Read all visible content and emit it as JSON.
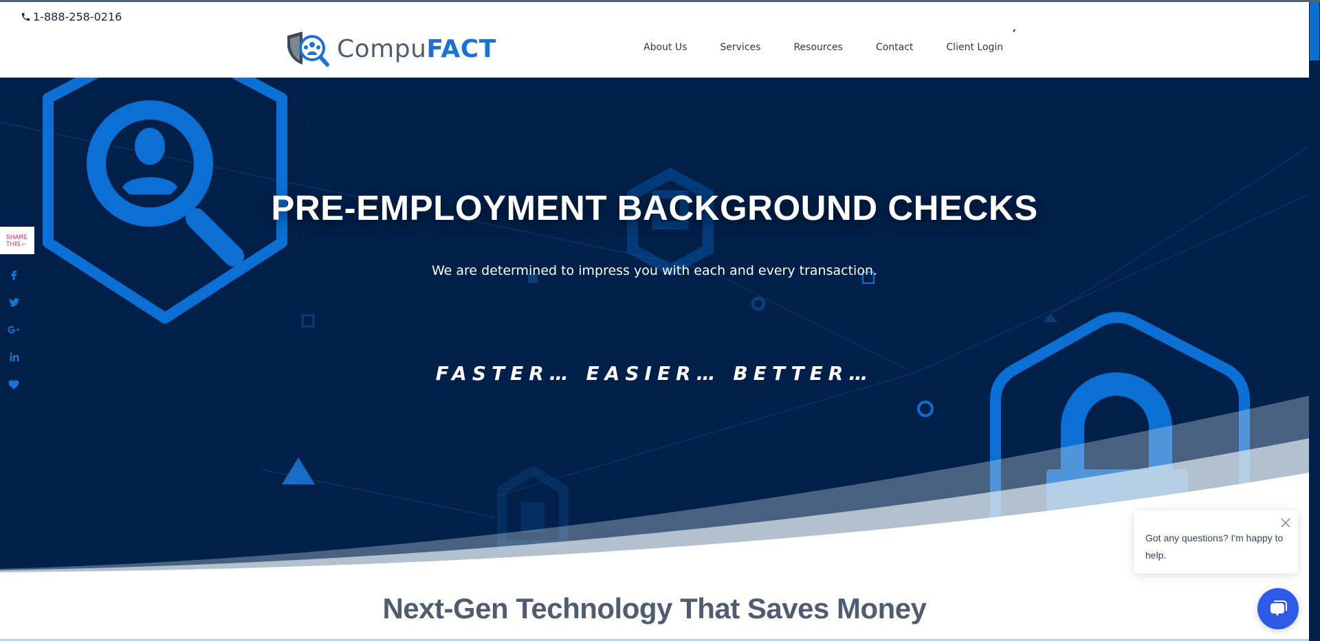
{
  "header": {
    "phone": "1-888-258-0216",
    "logo": {
      "part1": "Compu",
      "part2": "FACT"
    },
    "nav": [
      {
        "label": "About Us"
      },
      {
        "label": "Services"
      },
      {
        "label": "Resources"
      },
      {
        "label": "Contact"
      },
      {
        "label": "Client Login"
      }
    ]
  },
  "hero": {
    "title": "PRE-EMPLOYMENT BACKGROUND CHECKS",
    "subtitle": "We are determined to impress you with each and every transaction.",
    "tagline": "FASTER… EASIER… BETTER…"
  },
  "share": {
    "label_line1": "SHARE",
    "label_line2": "THIS ⌐",
    "icons": [
      "facebook-icon",
      "twitter-icon",
      "google-plus-icon",
      "linkedin-icon",
      "heart-icon"
    ]
  },
  "section": {
    "title": "Next-Gen Technology That Saves Money"
  },
  "chat": {
    "message": "Got any questions? I'm happy to help."
  },
  "colors": {
    "navy": "#00204a",
    "accent_blue": "#1a73d0",
    "heading_gray": "#4f5d6e",
    "share_pink": "#c2276d",
    "chat_blue": "#2e5be6"
  }
}
